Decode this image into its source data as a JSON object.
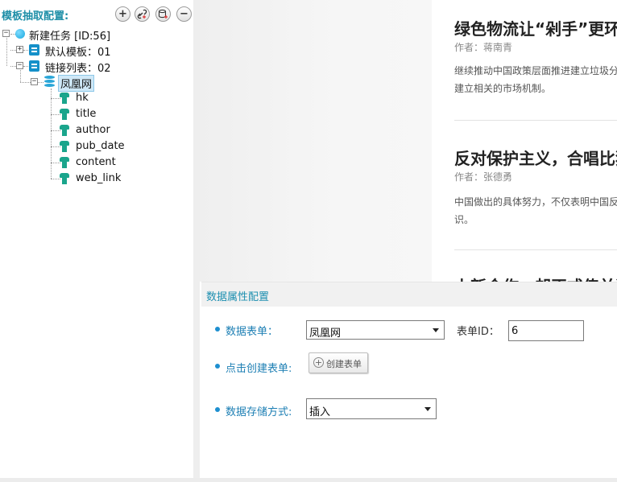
{
  "left_panel": {
    "title": "模板抽取配置:",
    "buttons": {
      "add": "+",
      "remove": "−"
    },
    "tree": {
      "root": "新建任务 [ID:56]",
      "default_template": "默认模板：01",
      "link_list": "链接列表：02",
      "source": "凤凰网",
      "fields": [
        "hk",
        "title",
        "author",
        "pub_date",
        "content",
        "web_link"
      ]
    }
  },
  "articles": [
    {
      "title": "绿色物流让“剁手”更环",
      "author": "作者：蒋南青",
      "summary": "继续推动中国政策层面推进建立垃圾分\n建立相关的市场机制。"
    },
    {
      "title": "反对保护主义，合唱比独",
      "author": "作者：张德勇",
      "summary": "中国做出的具体努力，不仅表明中国反\n识。"
    },
    {
      "title": "上新合作，却正式传并进",
      "author": "",
      "summary": ""
    }
  ],
  "config": {
    "title": "数据属性配置",
    "data_table_label": "数据表单：",
    "data_table_value": "凤凰网",
    "table_id_label": "表单ID：",
    "table_id_value": "6",
    "create_table_label": "点击创建表单:",
    "create_button_label": "创建表单",
    "storage_label": "数据存储方式:",
    "storage_value": "插入"
  }
}
